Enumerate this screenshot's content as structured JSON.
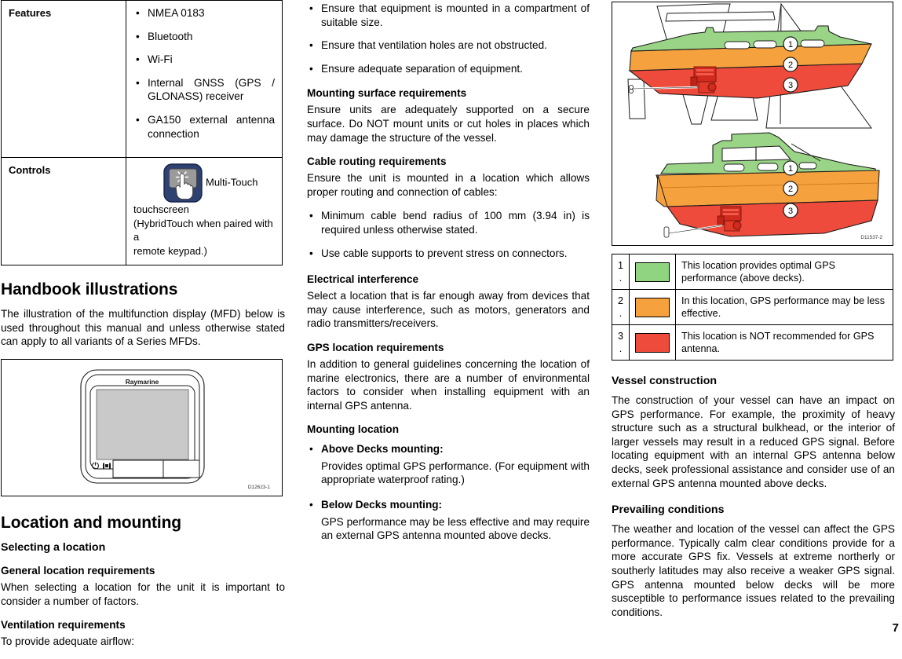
{
  "page": {
    "number": "7"
  },
  "spec_table": {
    "rows": [
      {
        "label": "Features",
        "items": [
          "NMEA 0183",
          "Bluetooth",
          "Wi-Fi",
          "Internal GNSS (GPS / GLONASS) receiver",
          "GA150 external antenna connection"
        ]
      },
      {
        "label": "Controls",
        "icon_name": "multi-touch-icon",
        "text_after_icon": "Multi-Touch",
        "text_line2": "touchscreen",
        "text_line3": "(HybridTouch when paired with a",
        "text_line4": "remote keypad.)"
      }
    ]
  },
  "handbook": {
    "heading": "Handbook illustrations",
    "paragraph": "The illustration of the multifunction display (MFD) below is used throughout this manual and unless otherwise stated can apply to all variants of a Series MFDs.",
    "figure": {
      "id": "D12623-1",
      "brand_label": "Raymarine",
      "power_icon": "power-icon",
      "home_icon": "home-icon"
    }
  },
  "location_mounting": {
    "heading": "Location and mounting",
    "sections": [
      {
        "title": "Selecting a location"
      },
      {
        "title": "General location requirements",
        "body": "When selecting a location for the unit it is important to consider a number of factors."
      },
      {
        "title": "Ventilation requirements",
        "body": "To provide adequate airflow:"
      }
    ]
  },
  "middle": {
    "ventilation_bullets": [
      "Ensure that equipment is mounted in a compartment of suitable size.",
      "Ensure that ventilation holes are not obstructed.",
      "Ensure adequate separation of equipment."
    ],
    "mounting_surface": {
      "title": "Mounting surface requirements",
      "body": "Ensure units are adequately supported on a secure surface. Do NOT mount units or cut holes in places which may damage the structure of the vessel."
    },
    "cable_routing": {
      "title": "Cable routing requirements",
      "body": "Ensure the unit is mounted in a location which allows proper routing and connection of cables:",
      "bullets": [
        "Minimum cable bend radius of 100 mm (3.94 in) is required unless otherwise stated.",
        "Use cable supports to prevent stress on connectors."
      ]
    },
    "electrical_interference": {
      "title": "Electrical interference",
      "body": "Select a location that is far enough away from devices that may cause interference, such as motors, generators and radio transmitters/receivers."
    },
    "gps_location": {
      "title": "GPS location requirements",
      "body": "In addition to general guidelines concerning the location of marine electronics, there are a number of environmental factors to consider when installing equipment with an internal GPS antenna."
    },
    "mounting_location": {
      "title": "Mounting location",
      "items": [
        {
          "label": "Above Decks mounting:",
          "body": "Provides optimal GPS performance. (For equipment with appropriate waterproof rating.)"
        },
        {
          "label": "Below Decks mounting:",
          "body": "GPS performance may be less effective and may require an external GPS antenna mounted above decks."
        }
      ]
    }
  },
  "right": {
    "figure": {
      "id": "D11537-2",
      "callouts": [
        "1",
        "2",
        "3"
      ],
      "vessels": [
        "sailboat",
        "motorboat"
      ]
    },
    "legend": {
      "rows": [
        {
          "num": "1",
          "dot": ".",
          "color": "#90d381",
          "text": "This location provides optimal GPS performance (above decks)."
        },
        {
          "num": "2",
          "dot": ".",
          "color": "#f5a23e",
          "text": "In this location, GPS performance may be less effective."
        },
        {
          "num": "3",
          "dot": ".",
          "color": "#ee4b3c",
          "text": "This location is NOT recommended for GPS antenna."
        }
      ]
    },
    "vessel_construction": {
      "title": "Vessel construction",
      "body": "The construction of your vessel can have an impact on GPS performance. For example, the proximity of heavy structure such as a structural bulkhead, or the interior of larger vessels may result in a reduced GPS signal. Before locating equipment with an internal GPS antenna below decks, seek professional assistance and consider use of an external GPS antenna mounted above decks."
    },
    "prevailing_conditions": {
      "title": "Prevailing conditions",
      "body": "The weather and location of the vessel can affect the GPS performance. Typically calm clear conditions provide for a more accurate GPS fix. Vessels at extreme northerly or southerly latitudes may also receive a weaker GPS signal. GPS antenna mounted below decks will be more susceptible to performance issues related to the prevailing conditions."
    }
  },
  "bullet_glyph": "•"
}
